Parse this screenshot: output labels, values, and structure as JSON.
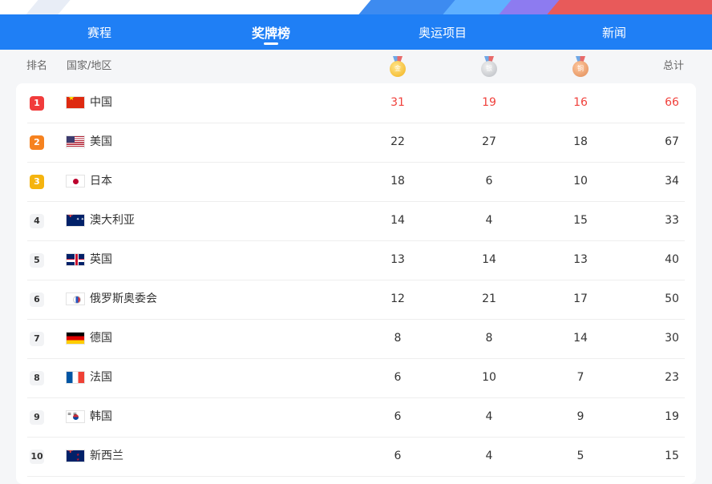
{
  "nav": {
    "tabs": [
      {
        "label": "赛程"
      },
      {
        "label": "奖牌榜"
      },
      {
        "label": "奥运项目"
      },
      {
        "label": "新闻"
      }
    ]
  },
  "header": {
    "rank": "排名",
    "country": "国家/地区",
    "gold": "金",
    "silver": "银",
    "bronze": "铜",
    "total": "总计"
  },
  "rows": [
    {
      "rank": "1",
      "flag": "china-flag",
      "name": "中国",
      "gold": "31",
      "silver": "19",
      "bronze": "16",
      "total": "66"
    },
    {
      "rank": "2",
      "flag": "usa-flag",
      "name": "美国",
      "gold": "22",
      "silver": "27",
      "bronze": "18",
      "total": "67"
    },
    {
      "rank": "3",
      "flag": "japan-flag",
      "name": "日本",
      "gold": "18",
      "silver": "6",
      "bronze": "10",
      "total": "34"
    },
    {
      "rank": "4",
      "flag": "australia-flag",
      "name": "澳大利亚",
      "gold": "14",
      "silver": "4",
      "bronze": "15",
      "total": "33"
    },
    {
      "rank": "5",
      "flag": "uk-flag",
      "name": "英国",
      "gold": "13",
      "silver": "14",
      "bronze": "13",
      "total": "40"
    },
    {
      "rank": "6",
      "flag": "roc-flag",
      "name": "俄罗斯奥委会",
      "gold": "12",
      "silver": "21",
      "bronze": "17",
      "total": "50"
    },
    {
      "rank": "7",
      "flag": "germany-flag",
      "name": "德国",
      "gold": "8",
      "silver": "8",
      "bronze": "14",
      "total": "30"
    },
    {
      "rank": "8",
      "flag": "france-flag",
      "name": "法国",
      "gold": "6",
      "silver": "10",
      "bronze": "7",
      "total": "23"
    },
    {
      "rank": "9",
      "flag": "korea-flag",
      "name": "韩国",
      "gold": "6",
      "silver": "4",
      "bronze": "9",
      "total": "19"
    },
    {
      "rank": "10",
      "flag": "new-zealand-flag",
      "name": "新西兰",
      "gold": "6",
      "silver": "4",
      "bronze": "5",
      "total": "15"
    }
  ],
  "colors": {
    "nav_blue": "#1f7ff5",
    "highlight_red": "#f0413c",
    "rank1": "#f13c3c",
    "rank2": "#f6821f",
    "rank3": "#f5b40f"
  }
}
